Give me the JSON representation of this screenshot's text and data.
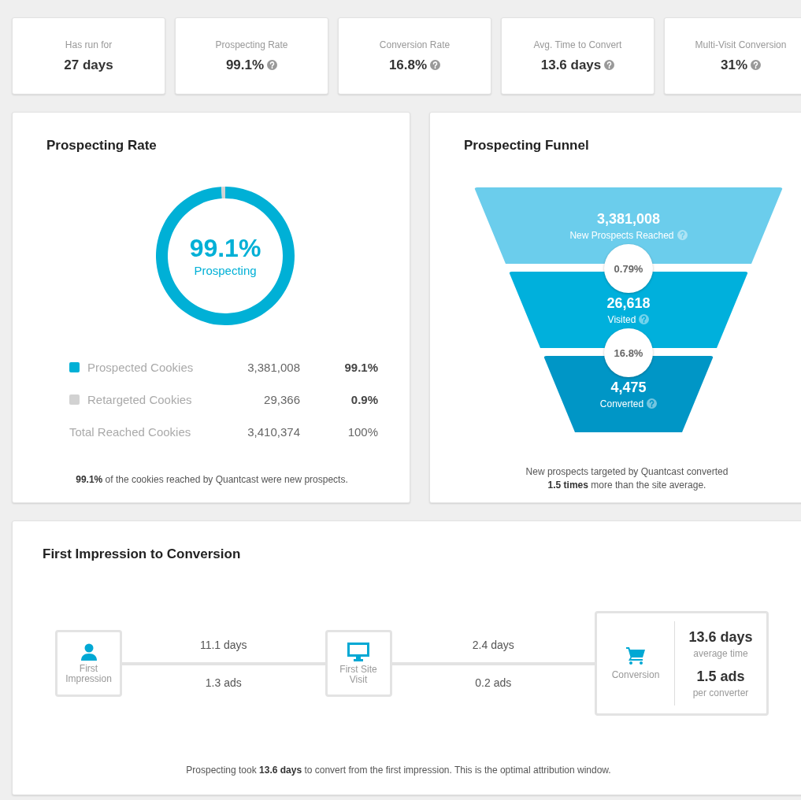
{
  "stats": [
    {
      "label": "Has run for",
      "value": "27 days",
      "help": false
    },
    {
      "label": "Prospecting Rate",
      "value": "99.1%",
      "help": true
    },
    {
      "label": "Conversion Rate",
      "value": "16.8%",
      "help": true
    },
    {
      "label": "Avg. Time to Convert",
      "value": "13.6 days",
      "help": true
    },
    {
      "label": "Multi-Visit Conversion",
      "value": "31%",
      "help": true
    }
  ],
  "prospecting_rate": {
    "title": "Prospecting Rate",
    "center_value": "99.1%",
    "center_label": "Prospecting",
    "chart_data": {
      "type": "donut",
      "values": [
        99.1,
        0.9
      ]
    },
    "legend": [
      {
        "kind": "swatch",
        "label": "Prospected Cookies",
        "count": "3,381,008",
        "share": "99.1%",
        "color": "#00b0d6"
      },
      {
        "kind": "swatch",
        "label": "Retargeted Cookies",
        "count": "29,366",
        "share": "0.9%",
        "color": "#d2d2d2"
      },
      {
        "kind": "total",
        "label": "Total Reached Cookies",
        "count": "3,410,374",
        "share": "100%"
      }
    ],
    "note": "**99.1%** of the cookies reached by Quantcast were new prospects."
  },
  "funnel": {
    "title": "Prospecting Funnel",
    "stages": [
      {
        "value": "3,381,008",
        "label": "New Prospects Reached",
        "color": "#6bcdec"
      },
      {
        "value": "26,618",
        "label": "Visited",
        "color": "#00b0dc"
      },
      {
        "value": "4,475",
        "label": "Converted",
        "color": "#0096c6"
      }
    ],
    "rates": [
      "0.79%",
      "16.8%"
    ],
    "note": "New prospects targeted by Quantcast converted\n**1.5 times** more than the site average."
  },
  "timeline": {
    "title": "First Impression to Conversion",
    "steps": [
      {
        "kind": "person",
        "label": "First Impression"
      },
      {
        "kind": "monitor",
        "label": "First Site Visit"
      }
    ],
    "segments": [
      {
        "time": "11.1 days",
        "ads": "1.3 ads"
      },
      {
        "time": "2.4 days",
        "ads": "0.2 ads"
      }
    ],
    "result": {
      "label": "Conversion",
      "time": "13.6 days",
      "time_caption": "average time",
      "ads": "1.5 ads",
      "ads_caption": "per converter"
    },
    "note": "Prospecting took **13.6 days** to convert from the first impression. This is the optimal attribution window."
  }
}
